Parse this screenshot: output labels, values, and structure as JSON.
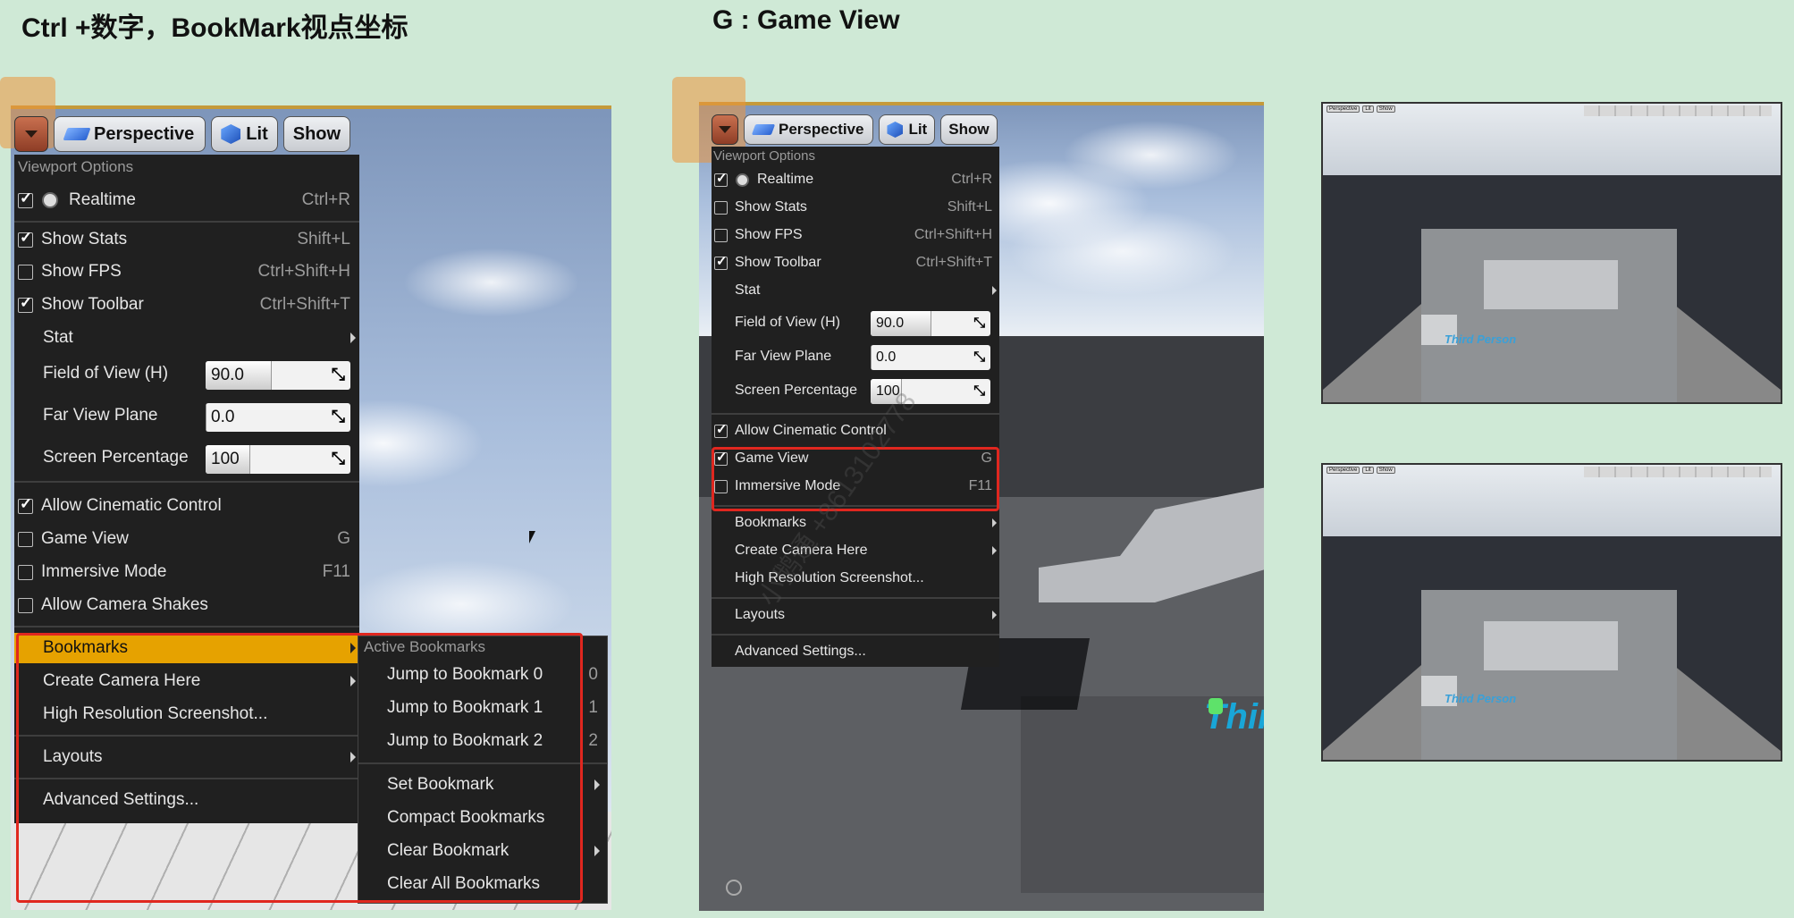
{
  "headings": {
    "left": "Ctrl +数字，BookMark视点坐标",
    "right": "G : Game View"
  },
  "toolbar": {
    "perspective_label": "Perspective",
    "lit_label": "Lit",
    "show_label": "Show"
  },
  "left_menu": {
    "section_title": "Viewport Options",
    "realtime": {
      "label": "Realtime",
      "shortcut": "Ctrl+R",
      "checked": true
    },
    "show_stats": {
      "label": "Show Stats",
      "shortcut": "Shift+L",
      "checked": true
    },
    "show_fps": {
      "label": "Show FPS",
      "shortcut": "Ctrl+Shift+H",
      "checked": false
    },
    "show_toolbar": {
      "label": "Show Toolbar",
      "shortcut": "Ctrl+Shift+T",
      "checked": true
    },
    "stat": {
      "label": "Stat"
    },
    "fov": {
      "label": "Field of View (H)",
      "value": "90.0",
      "fill": 0.45
    },
    "far_view": {
      "label": "Far View Plane",
      "value": "0.0",
      "fill": 0.0
    },
    "screen_pct": {
      "label": "Screen Percentage",
      "value": "100",
      "fill": 0.3
    },
    "cinematic": {
      "label": "Allow Cinematic Control",
      "checked": true
    },
    "game_view": {
      "label": "Game View",
      "shortcut": "G",
      "checked": false
    },
    "immersive": {
      "label": "Immersive Mode",
      "shortcut": "F11",
      "checked": false
    },
    "camera_shakes": {
      "label": "Allow Camera Shakes",
      "checked": false
    },
    "bookmarks": {
      "label": "Bookmarks"
    },
    "create_camera": {
      "label": "Create Camera Here"
    },
    "high_res": {
      "label": "High Resolution Screenshot..."
    },
    "layouts": {
      "label": "Layouts"
    },
    "advanced": {
      "label": "Advanced Settings..."
    }
  },
  "bookmarks_submenu": {
    "section_title": "Active Bookmarks",
    "jump0": {
      "label": "Jump to Bookmark 0",
      "shortcut": "0"
    },
    "jump1": {
      "label": "Jump to Bookmark 1",
      "shortcut": "1"
    },
    "jump2": {
      "label": "Jump to Bookmark 2",
      "shortcut": "2"
    },
    "set": {
      "label": "Set Bookmark"
    },
    "compact": {
      "label": "Compact Bookmarks"
    },
    "clear": {
      "label": "Clear Bookmark"
    },
    "clear_all": {
      "label": "Clear All Bookmarks"
    }
  },
  "right_menu": {
    "section_title": "Viewport Options",
    "realtime": {
      "label": "Realtime",
      "shortcut": "Ctrl+R",
      "checked": true
    },
    "show_stats": {
      "label": "Show Stats",
      "shortcut": "Shift+L",
      "checked": false
    },
    "show_fps": {
      "label": "Show FPS",
      "shortcut": "Ctrl+Shift+H",
      "checked": false
    },
    "show_toolbar": {
      "label": "Show Toolbar",
      "shortcut": "Ctrl+Shift+T",
      "checked": true
    },
    "stat": {
      "label": "Stat"
    },
    "fov": {
      "label": "Field of View (H)",
      "value": "90.0",
      "fill": 0.5
    },
    "far_view": {
      "label": "Far View Plane",
      "value": "0.0",
      "fill": 0.0
    },
    "screen_pct": {
      "label": "Screen Percentage",
      "value": "100",
      "fill": 0.25
    },
    "cinematic": {
      "label": "Allow Cinematic Control",
      "checked": true
    },
    "game_view": {
      "label": "Game View",
      "shortcut": "G",
      "checked": true
    },
    "immersive": {
      "label": "Immersive Mode",
      "shortcut": "F11",
      "checked": false
    },
    "bookmarks": {
      "label": "Bookmarks"
    },
    "create_camera": {
      "label": "Create Camera Here"
    },
    "high_res": {
      "label": "High Resolution Screenshot..."
    },
    "layouts": {
      "label": "Layouts"
    },
    "advanced": {
      "label": "Advanced Settings..."
    }
  },
  "scene": {
    "third_person_text": "Third Pers",
    "thumb_label": "Third Person"
  },
  "watermark": "小鹅通 +8613102778"
}
